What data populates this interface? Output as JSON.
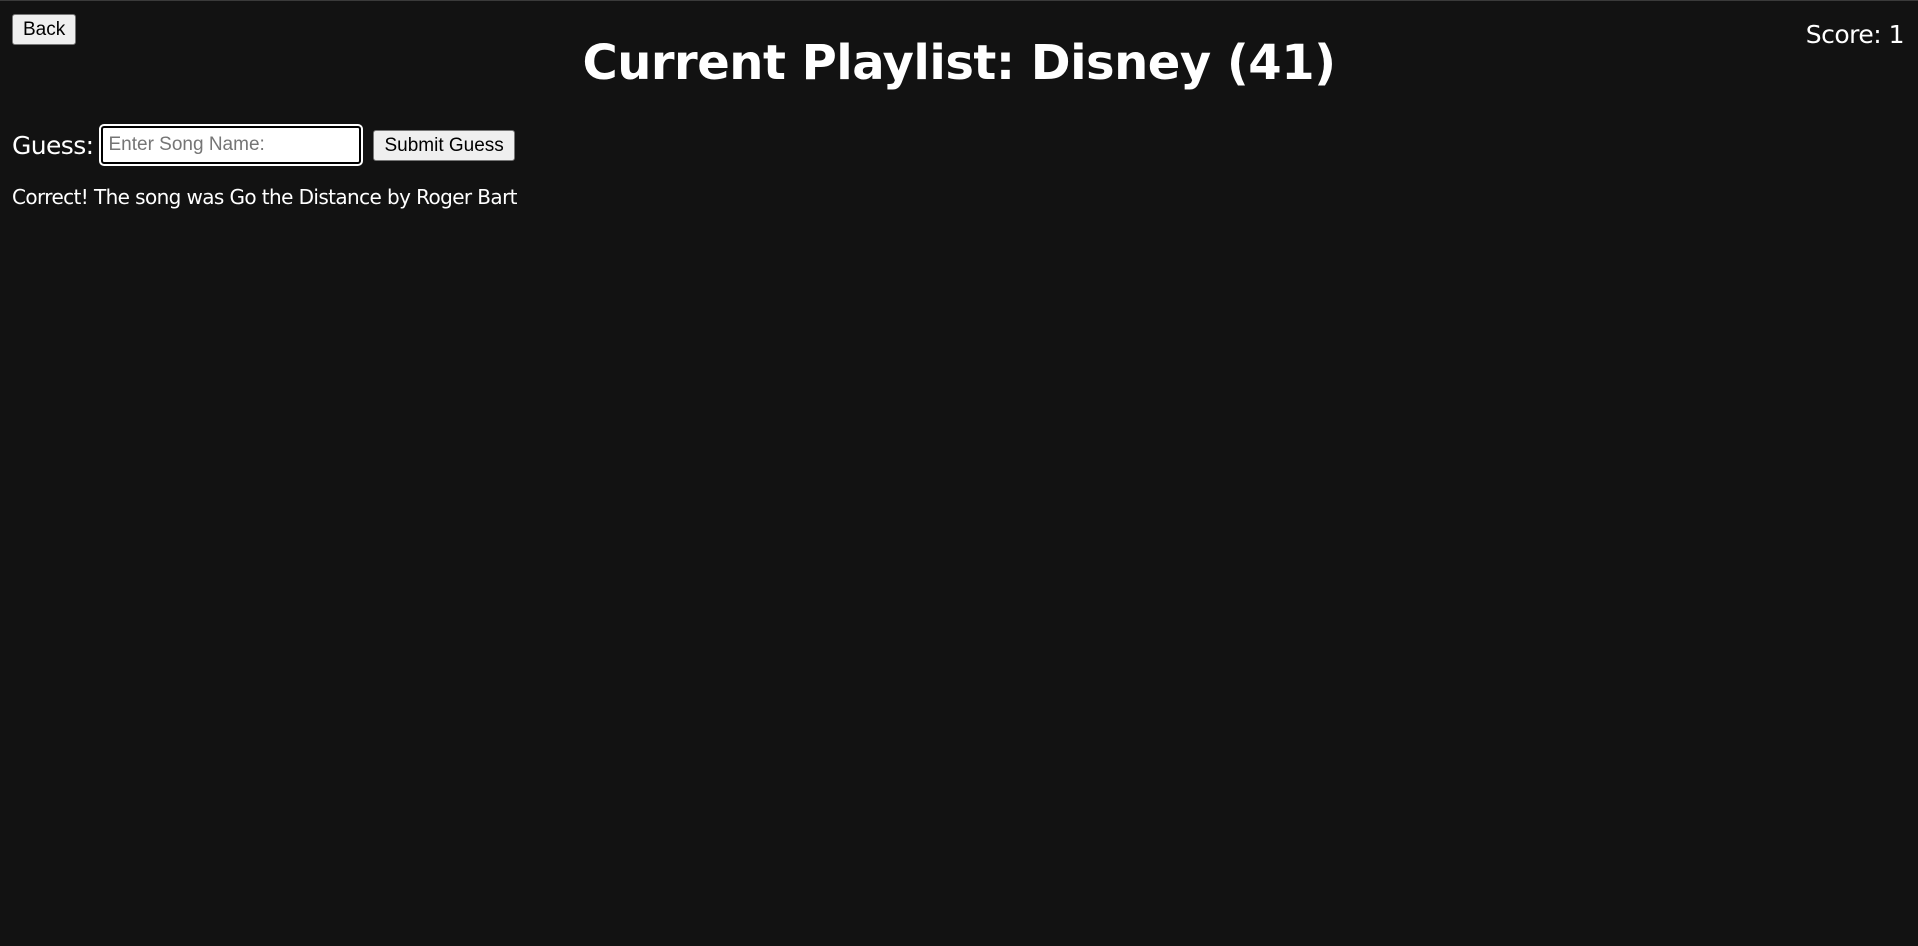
{
  "header": {
    "back_label": "Back",
    "title": "Current Playlist: Disney (41)",
    "score_text": "Score: 1"
  },
  "guess": {
    "label": "Guess:",
    "input_value": "",
    "input_placeholder": "Enter Song Name:",
    "submit_label": "Submit Guess"
  },
  "result": {
    "message": "Correct! The song was Go the Distance by Roger Bart"
  },
  "colors": {
    "background": "#121212",
    "text": "#ffffff",
    "button_bg": "#efefef"
  }
}
